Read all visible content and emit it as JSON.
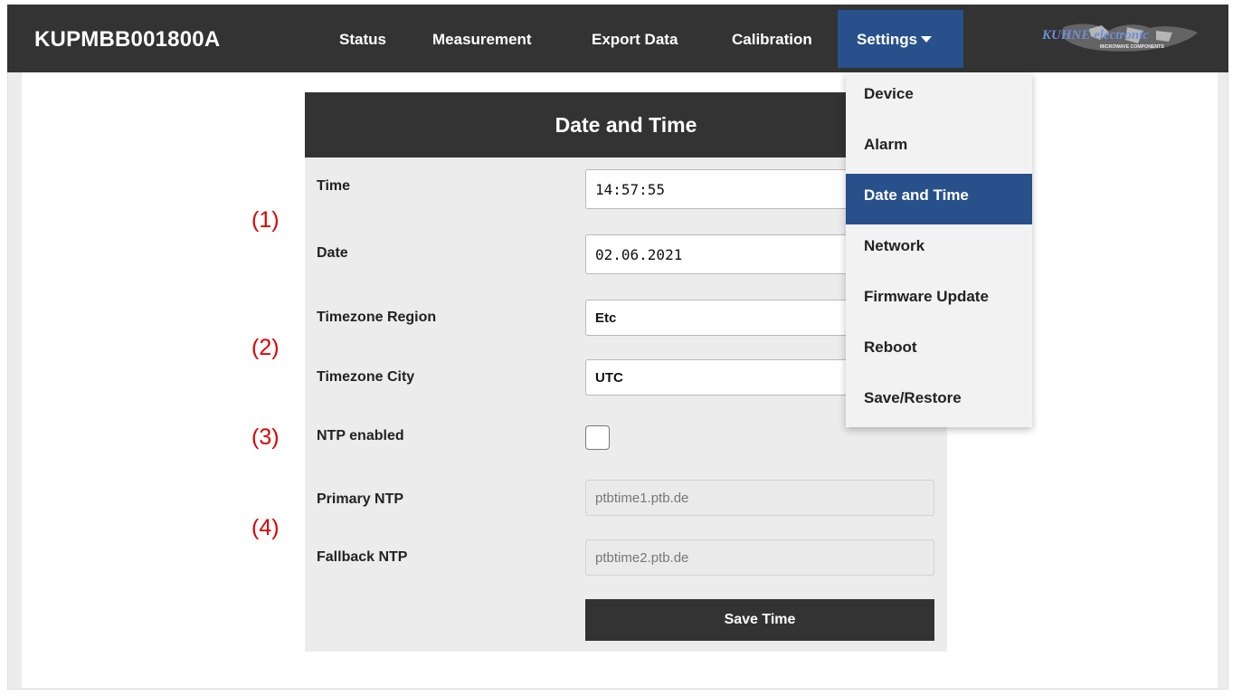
{
  "navbar": {
    "brand": "KUPMBB001800A",
    "items": [
      {
        "label": "Status"
      },
      {
        "label": "Measurement"
      },
      {
        "label": "Export Data"
      },
      {
        "label": "Calibration"
      }
    ],
    "settings_label": "Settings",
    "logo_text": "KUHNE electronic",
    "logo_sub": "MICROWAVE COMPONENTS"
  },
  "settings_menu": {
    "items": [
      {
        "label": "Device"
      },
      {
        "label": "Alarm"
      },
      {
        "label": "Date and Time",
        "active": true
      },
      {
        "label": "Network"
      },
      {
        "label": "Firmware Update"
      },
      {
        "label": "Reboot"
      },
      {
        "label": "Save/Restore"
      }
    ]
  },
  "form": {
    "title": "Date and Time",
    "time_label": "Time",
    "time_value": "14:57:55",
    "date_label": "Date",
    "date_value": "02.06.2021",
    "tz_region_label": "Timezone Region",
    "tz_region_value": "Etc",
    "tz_city_label": "Timezone City",
    "tz_city_value": "UTC",
    "ntp_enabled_label": "NTP enabled",
    "ntp_enabled": false,
    "primary_ntp_label": "Primary NTP",
    "primary_ntp_value": "ptbtime1.ptb.de",
    "fallback_ntp_label": "Fallback NTP",
    "fallback_ntp_value": "ptbtime2.ptb.de",
    "save_label": "Save Time"
  },
  "annotations": [
    "(1)",
    "(2)",
    "(3)",
    "(4)"
  ],
  "colors": {
    "navbar": "#333333",
    "accent": "#28508a",
    "annotation": "#e00000"
  }
}
